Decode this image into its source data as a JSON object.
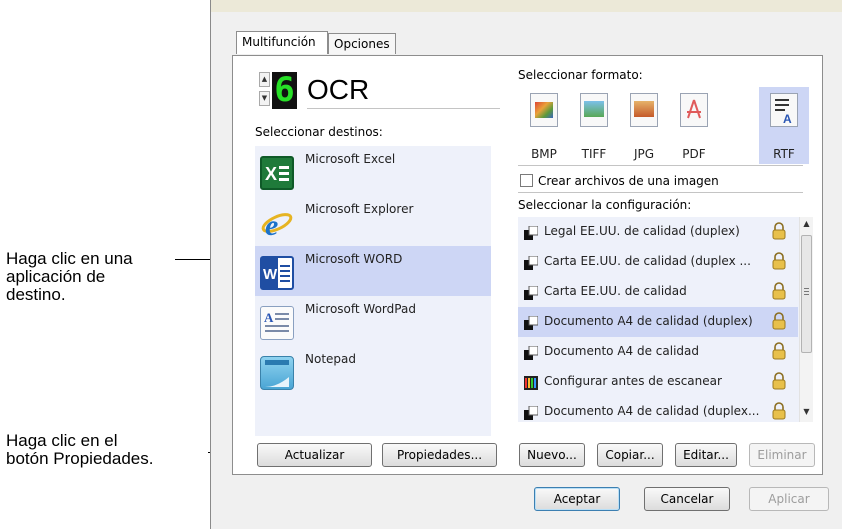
{
  "callouts": {
    "destination": "Haga clic en una aplicación de destino.",
    "destination_lines": [
      "Haga clic en una",
      "aplicación de",
      "destino."
    ],
    "properties_lines": [
      "Haga clic en el",
      "botón Propiedades."
    ]
  },
  "tabs": [
    {
      "label": "Multifunción",
      "active": true
    },
    {
      "label": "Opciones",
      "active": false
    }
  ],
  "config": {
    "number": "6",
    "name": "OCR"
  },
  "destinations": {
    "label": "Seleccionar destinos:",
    "items": [
      {
        "label": "Microsoft Excel",
        "icon": "excel-icon",
        "selected": false
      },
      {
        "label": "Microsoft Explorer",
        "icon": "internet-explorer-icon",
        "selected": false
      },
      {
        "label": "Microsoft WORD",
        "icon": "word-icon",
        "selected": true
      },
      {
        "label": "Microsoft WordPad",
        "icon": "wordpad-icon",
        "selected": false
      },
      {
        "label": "Notepad",
        "icon": "notepad-icon",
        "selected": false
      }
    ]
  },
  "formats": {
    "label": "Seleccionar formato:",
    "items": [
      {
        "label": "BMP",
        "selected": false,
        "color": "#c98b3a"
      },
      {
        "label": "TIFF",
        "selected": false,
        "color": "#58a856"
      },
      {
        "label": "JPG",
        "selected": false,
        "color": "#d9874a"
      },
      {
        "label": "PDF",
        "selected": false,
        "color": "#e05a5a"
      },
      {
        "label": "RTF",
        "selected": true,
        "color": "#3a5ab0"
      }
    ],
    "single_image_label": "Crear archivos de una imagen",
    "single_image_checked": false
  },
  "configurations": {
    "label": "Seleccionar la configuración:",
    "items": [
      {
        "label": "Legal EE.UU. de calidad (duplex)",
        "selected": false
      },
      {
        "label": "Carta EE.UU. de calidad (duplex ...",
        "selected": false
      },
      {
        "label": "Carta EE.UU. de calidad",
        "selected": false
      },
      {
        "label": "Documento A4 de calidad (duplex)",
        "selected": true
      },
      {
        "label": "Documento A4 de calidad",
        "selected": false
      },
      {
        "label": "Configurar antes de escanear",
        "selected": false
      },
      {
        "label": "Documento A4 de calidad (duplex...",
        "selected": false
      }
    ]
  },
  "buttons": {
    "refresh": "Actualizar",
    "properties": "Propiedades...",
    "new": "Nuevo...",
    "copy": "Copiar...",
    "edit": "Editar...",
    "delete": "Eliminar",
    "ok": "Aceptar",
    "cancel": "Cancelar",
    "apply": "Aplicar"
  },
  "colors": {
    "selection": "#cdd6f5",
    "list_background": "#eef1fa",
    "lcd_digit": "#27e027"
  }
}
